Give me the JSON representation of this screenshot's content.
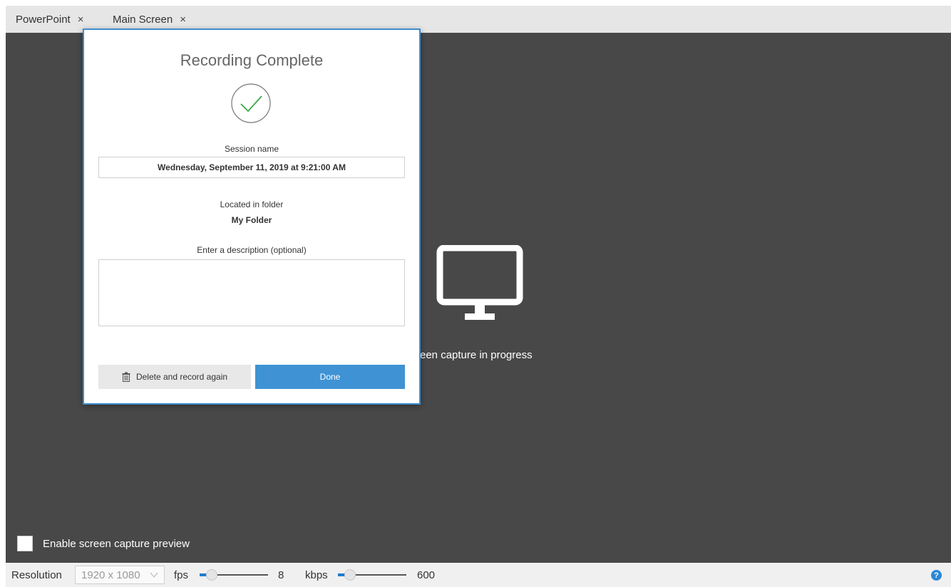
{
  "tabs": [
    {
      "label": "PowerPoint",
      "close": "×"
    },
    {
      "label": "Main Screen",
      "close": "×"
    }
  ],
  "stage": {
    "capture_text": "reen capture in progress",
    "monitor_icon": "monitor-icon",
    "preview_label": "Enable screen capture preview",
    "preview_checked": false
  },
  "statusbar": {
    "resolution_label": "Resolution",
    "resolution_value": "1920 x 1080",
    "fps_label": "fps",
    "fps_value": "8",
    "fps_level": 0.18,
    "kbps_label": "kbps",
    "kbps_value": "600",
    "kbps_level": 0.18,
    "help_label": "?"
  },
  "dialog": {
    "title": "Recording Complete",
    "check_icon": "checkmark-circle-icon",
    "session_label": "Session name",
    "session_value": "Wednesday, September 11, 2019 at 9:21:00 AM",
    "folder_label": "Located in folder",
    "folder_value": "My Folder",
    "description_label": "Enter a description (optional)",
    "description_value": "",
    "delete_button": "Delete and record again",
    "done_button": "Done"
  },
  "colors": {
    "stage_bg": "#484848",
    "accent": "#3f93d4",
    "check_green": "#3aaa4a",
    "slider_fill": "#1e7bd0"
  }
}
